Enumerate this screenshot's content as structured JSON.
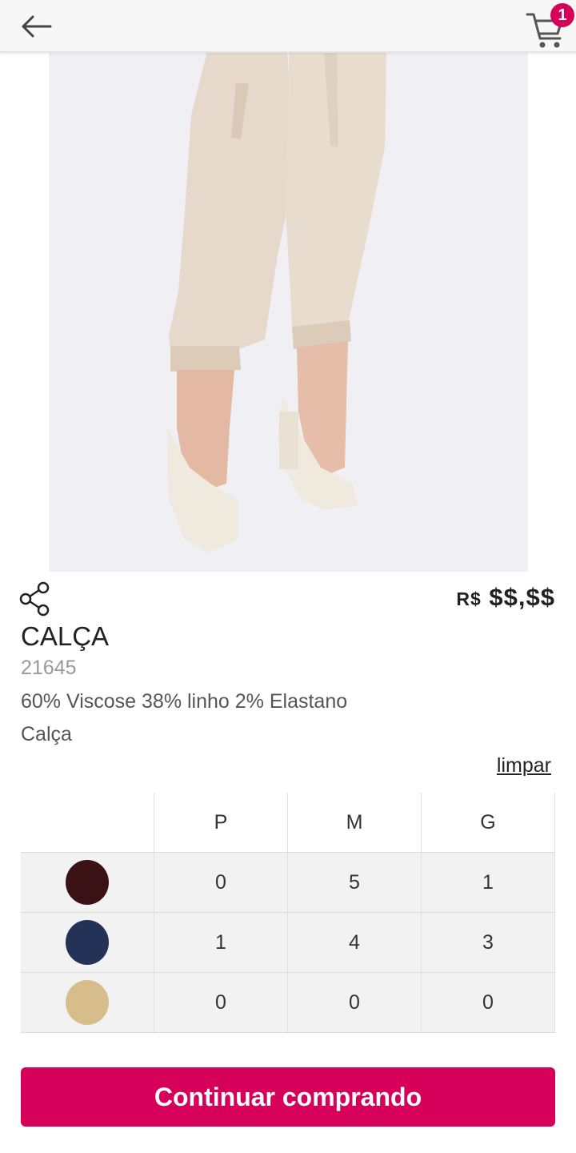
{
  "header": {
    "back_icon": "arrow-left-icon",
    "cart_icon": "cart-icon",
    "cart_count": "1",
    "accent_color": "#d6005a"
  },
  "gallery": {
    "image": "beige-pants-product-photo",
    "dot_count": 4,
    "active_dot": 0
  },
  "product": {
    "share_icon": "share-icon",
    "currency": "R$",
    "price": "$$,$$",
    "name": "CALÇA",
    "code": "21645",
    "composition": "60% Viscose 38% linho 2% Elastano",
    "category": "Calça"
  },
  "grid": {
    "clear_label": "limpar",
    "sizes": [
      "P",
      "M",
      "G"
    ],
    "rows": [
      {
        "color": "#3a1114",
        "quantities": [
          "0",
          "5",
          "1"
        ]
      },
      {
        "color": "#243257",
        "quantities": [
          "1",
          "4",
          "3"
        ]
      },
      {
        "color": "#d7bd8c",
        "quantities": [
          "0",
          "0",
          "0"
        ]
      }
    ]
  },
  "actions": {
    "continue_label": "Continuar comprando"
  }
}
